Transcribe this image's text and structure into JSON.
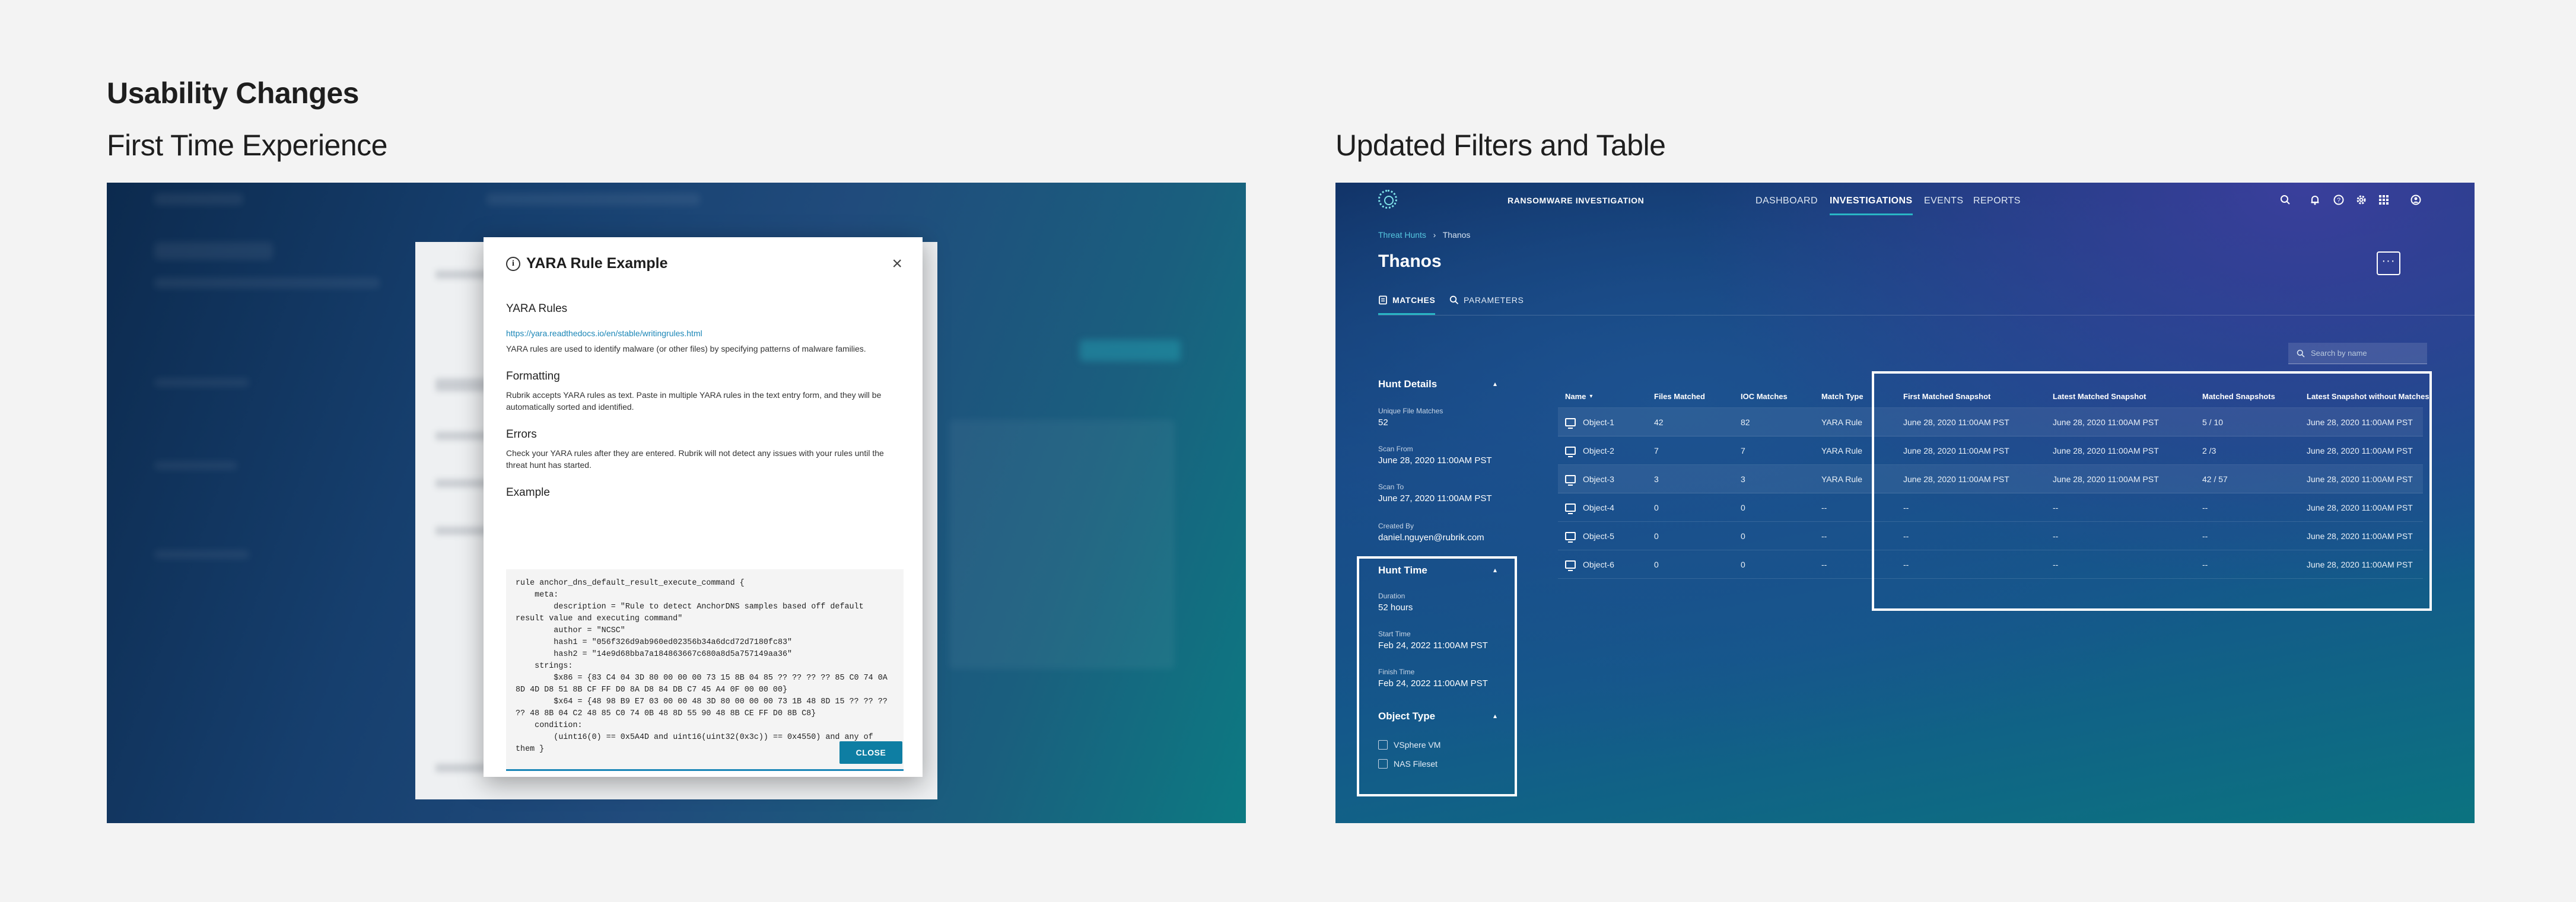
{
  "headings": {
    "main": "Usability Changes",
    "left": "First Time Experience",
    "right": "Updated Filters and Table"
  },
  "modal": {
    "title": "YARA Rule Example",
    "close_icon": "close-icon",
    "sections": [
      {
        "heading": "YARA Rules",
        "link": "https://yara.readthedocs.io/en/stable/writingrules.html",
        "text": "YARA rules are used to identify malware (or other files) by specifying patterns of malware families."
      },
      {
        "heading": "Formatting",
        "text": "Rubrik accepts YARA rules as text. Paste in multiple YARA rules in the text entry form, and they will be automatically sorted and identified."
      },
      {
        "heading": "Errors",
        "text": "Check your YARA rules after they are entered. Rubrik will not detect any issues with your rules until the threat hunt has started."
      },
      {
        "heading": "Example"
      }
    ],
    "code": "rule anchor_dns_default_result_execute_command {\n    meta:\n        description = \"Rule to detect AnchorDNS samples based off default result value and executing command\"\n        author = \"NCSC\"\n        hash1 = \"056f326d9ab960ed02356b34a6dcd72d7180fc83\"\n        hash2 = \"14e9d68bba7a184863667c680a8d5a757149aa36\"\n    strings:\n        $x86 = {83 C4 04 3D 80 00 00 00 73 15 8B 04 85 ?? ?? ?? ?? 85 C0 74 0A 8D 4D D8 51 8B CF FF D0 8A D8 84 DB C7 45 A4 0F 00 00 00}\n        $x64 = {48 98 B9 E7 03 00 00 48 3D 80 00 00 00 73 1B 48 8D 15 ?? ?? ?? ?? 48 8B 04 C2 48 85 C0 74 0B 48 8D 55 90 48 8B CE FF D0 8B C8}\n    condition:\n        (uint16(0) == 0x5A4D and uint16(uint32(0x3c)) == 0x4550) and any of them }",
    "close_button": "CLOSE"
  },
  "app": {
    "name": "RANSOMWARE INVESTIGATION",
    "nav": [
      "DASHBOARD",
      "INVESTIGATIONS",
      "EVENTS",
      "REPORTS"
    ],
    "active_nav": "INVESTIGATIONS",
    "breadcrumb": {
      "parent": "Threat Hunts",
      "current": "Thanos"
    },
    "page_title": "Thanos",
    "tabs": [
      "MATCHES",
      "PARAMETERS"
    ],
    "search_placeholder": "Search by name",
    "accent": "#29b6c5"
  },
  "sidebar": {
    "hunt_details": {
      "title": "Hunt Details",
      "fields": [
        {
          "label": "Unique File Matches",
          "value": "52"
        },
        {
          "label": "Scan From",
          "value": "June 28, 2020 11:00AM PST"
        },
        {
          "label": "Scan To",
          "value": "June 27, 2020 11:00AM PST"
        },
        {
          "label": "Created By",
          "value": "daniel.nguyen@rubrik.com"
        }
      ]
    },
    "hunt_time": {
      "title": "Hunt Time",
      "fields": [
        {
          "label": "Duration",
          "value": "52 hours"
        },
        {
          "label": "Start Time",
          "value": "Feb 24, 2022 11:00AM PST"
        },
        {
          "label": "Finish Time",
          "value": "Feb 24, 2022 11:00AM PST"
        }
      ]
    },
    "object_type": {
      "title": "Object Type",
      "options": [
        "VSphere VM",
        "NAS Fileset"
      ]
    }
  },
  "table": {
    "columns": [
      "Name",
      "Files Matched",
      "IOC Matches",
      "Match Type",
      "First Matched Snapshot",
      "Latest Matched Snapshot",
      "Matched Snapshots",
      "Latest Snapshot without Matches"
    ],
    "rows": [
      [
        "Object-1",
        "42",
        "82",
        "YARA Rule",
        "June 28, 2020 11:00AM PST",
        "June 28, 2020 11:00AM PST",
        "5 / 10",
        "June 28, 2020 11:00AM PST"
      ],
      [
        "Object-2",
        "7",
        "7",
        "YARA Rule",
        "June 28, 2020 11:00AM PST",
        "June 28, 2020 11:00AM PST",
        "2 /3",
        "June 28, 2020 11:00AM PST"
      ],
      [
        "Object-3",
        "3",
        "3",
        "YARA Rule",
        "June 28, 2020 11:00AM PST",
        "June 28, 2020 11:00AM PST",
        "42 / 57",
        "June 28, 2020 11:00AM PST"
      ],
      [
        "Object-4",
        "0",
        "0",
        "--",
        "--",
        "--",
        "--",
        "June 28, 2020 11:00AM PST"
      ],
      [
        "Object-5",
        "0",
        "0",
        "--",
        "--",
        "--",
        "--",
        "June 28, 2020 11:00AM PST"
      ],
      [
        "Object-6",
        "0",
        "0",
        "--",
        "--",
        "--",
        "--",
        "June 28, 2020 11:00AM PST"
      ]
    ]
  }
}
